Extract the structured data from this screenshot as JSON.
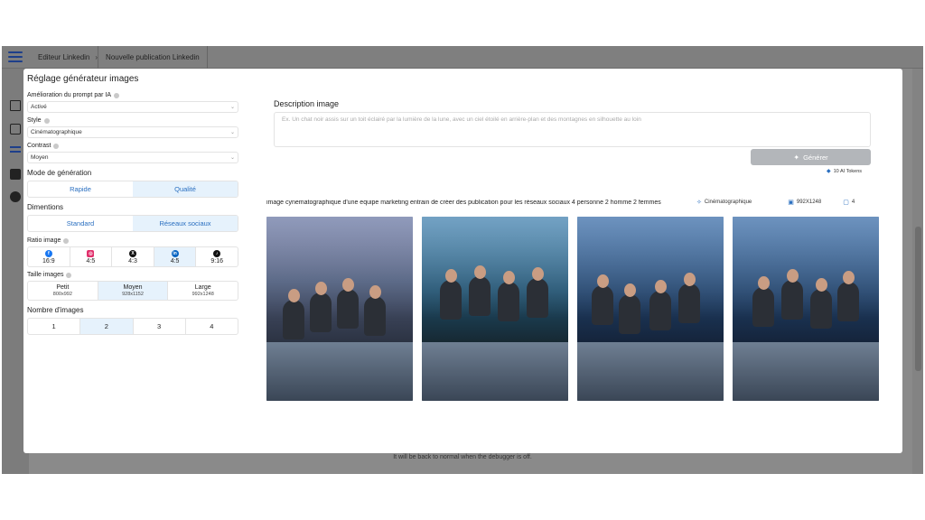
{
  "breadcrumbs": [
    "Editeur Linkedin",
    "Nouvelle publication Linkedin"
  ],
  "debug_note": "It will be back to normal when the debugger is off.",
  "settings": {
    "title": "Réglage générateur images",
    "prompt_ai": {
      "label": "Amélioration du prompt par IA",
      "value": "Activé"
    },
    "style": {
      "label": "Style",
      "value": "Cinématographique"
    },
    "contrast": {
      "label": "Contrast",
      "value": "Moyen"
    },
    "mode": {
      "label": "Mode de génération",
      "options": [
        "Rapide",
        "Qualité"
      ],
      "selected": "Qualité"
    },
    "dimensions": {
      "label": "Dimentions",
      "options": [
        "Standard",
        "Réseaux sociaux"
      ],
      "selected": "Réseaux sociaux"
    },
    "ratio": {
      "label": "Ratio image",
      "options": [
        {
          "icon": "facebook-icon",
          "value": "16:9",
          "color": "#1877f2"
        },
        {
          "icon": "instagram-icon",
          "value": "4:5",
          "color": "#e1306c"
        },
        {
          "icon": "x-icon",
          "value": "4:3",
          "color": "#111111"
        },
        {
          "icon": "linkedin-icon",
          "value": "4:5",
          "color": "#0a66c2"
        },
        {
          "icon": "tiktok-icon",
          "value": "9:16",
          "color": "#111111"
        }
      ],
      "selected_index": 3
    },
    "size": {
      "label": "Taille images",
      "options": [
        {
          "name": "Petit",
          "dim": "800x992"
        },
        {
          "name": "Moyen",
          "dim": "928x1152"
        },
        {
          "name": "Large",
          "dim": "992x1248"
        }
      ],
      "selected": "Moyen"
    },
    "count": {
      "label": "Nombre d'images",
      "options": [
        "1",
        "2",
        "3",
        "4"
      ],
      "selected": "2"
    }
  },
  "generator": {
    "desc_title": "Description image",
    "desc_placeholder": "Ex. Un chat noir assis sur un toit éclairé par la lumière de la lune, avec un ciel étoilé en arrière-plan et des montagnes en silhouette au loin",
    "generate_label": "Générer",
    "tokens": "10 AI Tokens"
  },
  "result": {
    "prompt": "image cynematographique d'une equipe marketing entrain de créer des publication pour les réseaux sociaux 4 personne 2 homme 2 femmes",
    "style": "Cinématographique",
    "dimension": "992X1248",
    "count": "4"
  }
}
